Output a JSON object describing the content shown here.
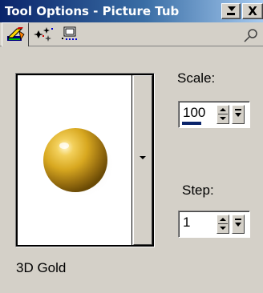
{
  "window": {
    "title": "Tool Options - Picture Tub",
    "min_icon": "minimize-menu-icon",
    "close_label": "X"
  },
  "tabs": [
    {
      "icon": "brush-tool-icon",
      "active": true
    },
    {
      "icon": "sparkle-options-icon",
      "active": false
    },
    {
      "icon": "tube-settings-icon",
      "active": false
    }
  ],
  "pin_icon": "pin-icon",
  "preview": {
    "tube_name": "3D Gold",
    "image": "gold-sphere",
    "colors": {
      "highlight": "#fff8d0",
      "mid": "#d8a820",
      "dark": "#6a4a05"
    }
  },
  "scale": {
    "label": "Scale:",
    "value": "100",
    "level": 0.6
  },
  "step": {
    "label": "Step:",
    "value": "1"
  },
  "colors": {
    "titlebar_start": "#0a246a",
    "titlebar_end": "#a6caf0",
    "panel": "#d4d0c8",
    "progress": "#0a246a"
  }
}
